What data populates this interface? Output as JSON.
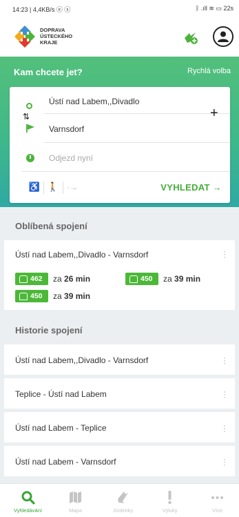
{
  "status_bar": {
    "left": "14:23 | 4,4KB/s ⓔ ⓢ",
    "right": "ᛒ .ıll ≋ ▭ 22s"
  },
  "header": {
    "logo_lines": [
      "DOPRAVA",
      "ÚSTECKÉHO",
      "KRAJE"
    ]
  },
  "hero": {
    "title": "Kam chcete jet?",
    "quick_link": "Rychlá volba"
  },
  "search": {
    "from": "Ústí nad Labem,,Divadlo",
    "to": "Varnsdorf",
    "time_placeholder": "Odjezd nyní",
    "submit_label": "VYHLEDAT →",
    "plus": "+"
  },
  "favorites": {
    "heading": "Oblíbená spojení",
    "route": "Ústí nad Labem,,Divadlo - Varnsdorf",
    "departures": [
      {
        "line": "462",
        "prefix": "za",
        "time": "26 min"
      },
      {
        "line": "450",
        "prefix": "za",
        "time": "39 min"
      },
      {
        "line": "450",
        "prefix": "za",
        "time": "39 min"
      }
    ]
  },
  "history": {
    "heading": "Historie spojení",
    "items": [
      {
        "route": "Ústí nad Labem,,Divadlo - Varnsdorf"
      },
      {
        "route": "Teplice - Ústí nad Labem"
      },
      {
        "route": "Ústí nad Labem - Teplice"
      },
      {
        "route": "Ústí nad Labem - Varnsdorf"
      }
    ]
  },
  "nav": {
    "items": [
      {
        "label": "Vyhledávání",
        "icon": "search-icon"
      },
      {
        "label": "Mapa",
        "icon": "map-icon"
      },
      {
        "label": "Jízdenky",
        "icon": "ticket-icon"
      },
      {
        "label": "Výluky",
        "icon": "alert-icon"
      },
      {
        "label": "Více",
        "icon": "more-icon"
      }
    ]
  },
  "colors": {
    "accent": "#44ad3a",
    "hero_top": "#53c07b",
    "hero_bottom": "#2fa9a3"
  }
}
